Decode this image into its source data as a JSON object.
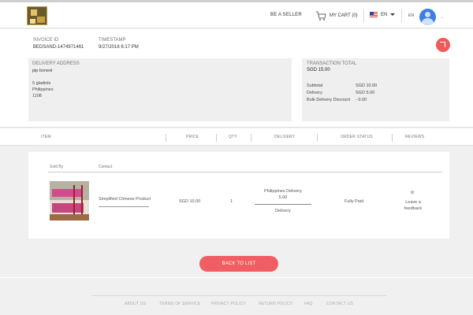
{
  "header": {
    "be_seller": "BE A SELLER",
    "cart": "MY CART (0)",
    "language": "EN",
    "language_small": "EN"
  },
  "invoice": {
    "id_label": "INVOICE ID",
    "id_value": "BEDSAND-1474971461",
    "timestamp_label": "TIMESTAMP",
    "timestamp_value": "9/27/2016 6:17 PM"
  },
  "delivery": {
    "title": "DELIVERY ADDRESS",
    "name": "pip boneol",
    "line1": "5 gladiols",
    "line2": "Philippines",
    "line3": "1108"
  },
  "transaction": {
    "title": "TRANSACTION TOTAL",
    "total": "SGD 15.00",
    "subtotal_label": "Subtotal",
    "subtotal_value": "SGD 10.00",
    "delivery_label": "Delivery",
    "delivery_value": "SGD 5.00",
    "bulk_label": "Bulk Delivery Discount",
    "bulk_value": "- 0.00"
  },
  "columns": [
    "ITEM",
    "PRICE",
    "QTY",
    "DELIVERY",
    "ORDER STATUS",
    "REVIEWS"
  ],
  "item": {
    "sold_by": "Sold By",
    "contact": "Contact",
    "product_name": "Simplified Chinese Product",
    "price": "SGD 10.00",
    "qty": "1",
    "delivery_line1": "Philippines Delivery",
    "delivery_line2": "5.00",
    "delivery_type": "Delivery",
    "status": "Fully Paid",
    "review_line1": "Leave a",
    "review_line2": "feedback"
  },
  "back_button": "BACK TO LIST",
  "footer": [
    "ABOUT US",
    "TERMS OF SERVICE",
    "PRIVACY POLICY",
    "RETURN POLICY",
    "FAQ",
    "CONTACT US"
  ],
  "colors": {
    "accent": "#f05d62",
    "avatar": "#3d7fe0"
  }
}
